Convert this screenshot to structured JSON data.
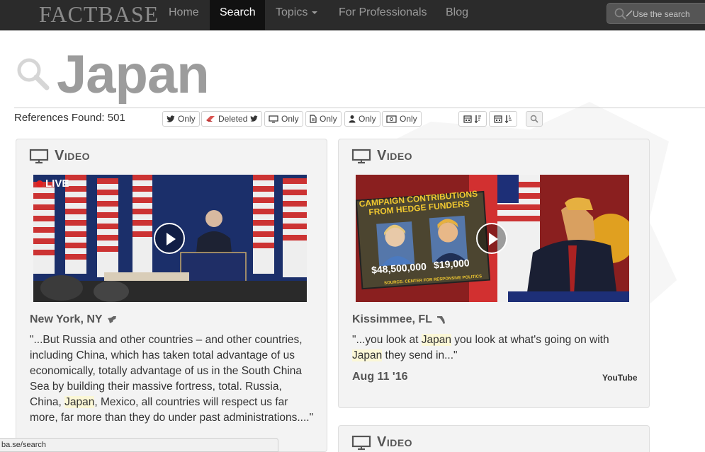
{
  "nav": {
    "brand": "FACTBASE",
    "items": [
      {
        "label": "Home"
      },
      {
        "label": "Search"
      },
      {
        "label": "Topics"
      },
      {
        "label": "For Professionals"
      },
      {
        "label": "Blog"
      }
    ],
    "search_placeholder": "Use the search"
  },
  "hero": {
    "title": "Japan"
  },
  "filters": {
    "references_found": "References Found: 501",
    "buttons": [
      {
        "label": "Only",
        "icon": "twitter-icon"
      },
      {
        "label": "Deleted",
        "icon": "eraser-icon"
      },
      {
        "label": "Only",
        "icon": "monitor-icon"
      },
      {
        "label": "Only",
        "icon": "document-icon"
      },
      {
        "label": "Only",
        "icon": "user-icon"
      },
      {
        "label": "Only",
        "icon": "money-icon"
      }
    ]
  },
  "cards": [
    {
      "type": "Video",
      "badge": "LIVE",
      "location": "New York, NY",
      "quote_parts": [
        "\"...But Russia and other countries – and other countries, including China, which has taken total advantage of us economically, totally advantage of us in the South China Sea by building their massive fortress, total. Russia, China, ",
        "Japan",
        ", Mexico, all countries will respect us far more, far more than they do under past administrations....\""
      ]
    },
    {
      "type": "Video",
      "poster_lines": [
        "CAMPAIGN CONTRIBUTIONS",
        "FROM HEDGE FUNDERS"
      ],
      "poster_amounts": [
        "$48,500,000",
        "$19,000"
      ],
      "poster_source": "SOURCE: CENTER FOR RESPONSIVE POLITICS",
      "location": "Kissimmee, FL",
      "quote_parts": [
        "\"...you look at ",
        "Japan",
        " you look at what's going on with ",
        "Japan",
        " they send in...\""
      ],
      "date": "Aug 11 '16",
      "source": "YouTube"
    },
    {
      "type": "Video"
    }
  ],
  "status_bar": {
    "url": "ba.se/search"
  },
  "colors": {
    "navbar": "#2b2b2b",
    "active_nav": "#111111",
    "card_bg": "#f3f3f3",
    "highlight": "#fbf7d6",
    "hero_text": "#9c9c9c"
  }
}
